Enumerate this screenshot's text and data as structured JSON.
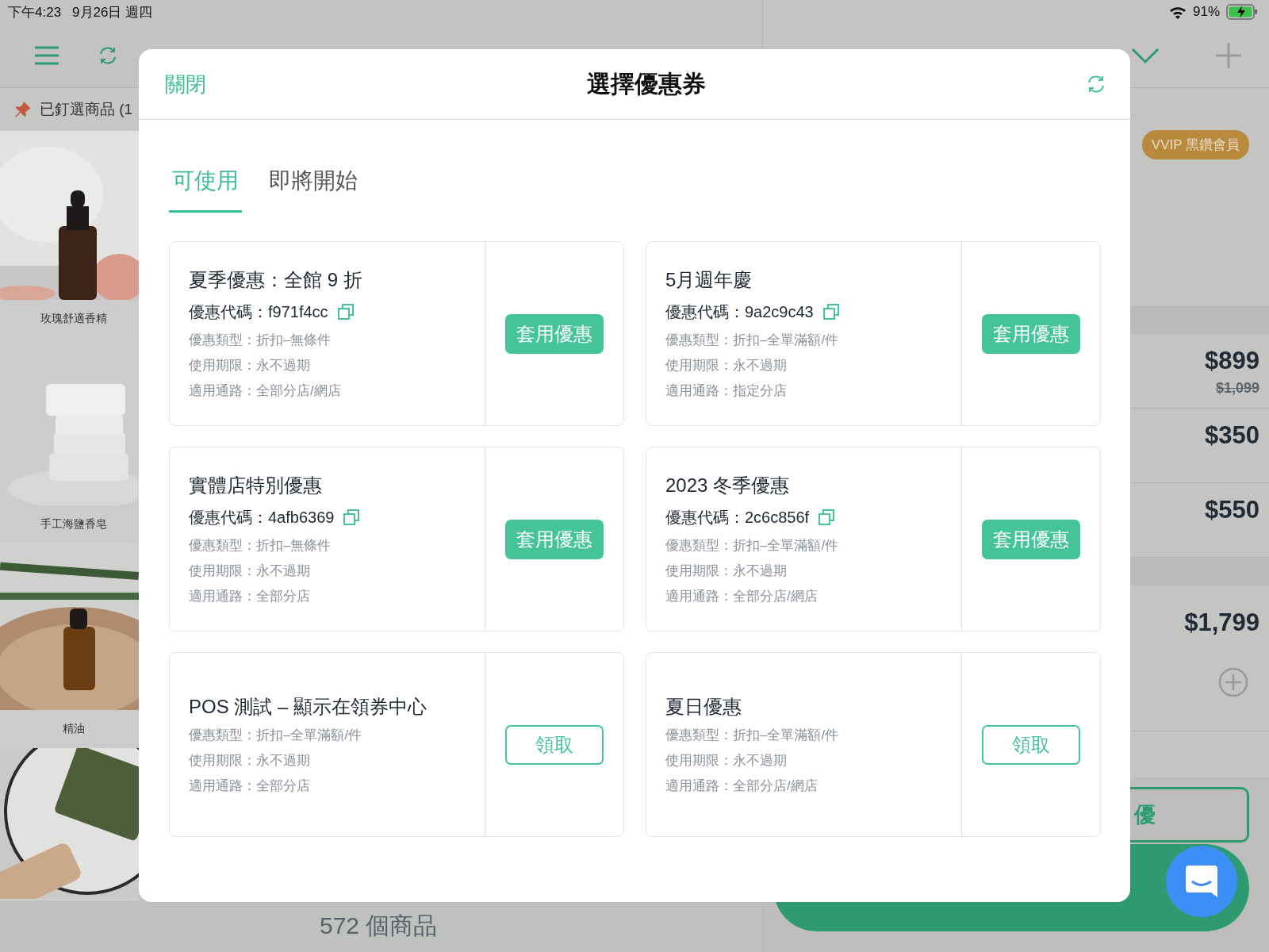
{
  "status_bar": {
    "time": "下午4:23",
    "date": "9月26日 週四",
    "battery": "91%"
  },
  "products": {
    "pinned_label": "已釘選商品 (1",
    "items": [
      {
        "name": "玫瑰舒適香精",
        "kind": "picture"
      },
      {
        "name": "手工海鹽香皂",
        "kind": "picture"
      },
      {
        "name": "精油",
        "kind": "picture"
      },
      {
        "kind": "picture"
      }
    ],
    "count": "572 個商品"
  },
  "cart": {
    "badge": "VVIP 黑鑽會員",
    "lines": [
      {
        "price": "$899",
        "original_price": "$1,099"
      },
      {
        "price": "$350"
      },
      {
        "price": "$550"
      }
    ],
    "subtotal": "$1,799",
    "coupon_button": "優"
  },
  "modal": {
    "close": "關閉",
    "title": "選擇優惠券",
    "tabs": [
      {
        "label": "可使用",
        "selected": true
      },
      {
        "label": "即將開始",
        "selected": false
      }
    ],
    "coupons": [
      {
        "kind": "apply",
        "title": "夏季優惠：全館 9 折",
        "code": "優惠代碼：f971f4cc",
        "details": [
          "優惠類型：折扣–無條件",
          "使用期限：永不過期",
          "適用通路：全部分店/網店"
        ],
        "action": "套用優惠"
      },
      {
        "kind": "apply",
        "title": "5月週年慶",
        "code": "優惠代碼：9a2c9c43",
        "details": [
          "優惠類型：折扣–全單滿額/件",
          "使用期限：永不過期",
          "適用通路：指定分店"
        ],
        "action": "套用優惠"
      },
      {
        "kind": "apply",
        "title": "實體店特別優惠",
        "code": "優惠代碼：4afb6369",
        "details": [
          "優惠類型：折扣–無條件",
          "使用期限：永不過期",
          "適用通路：全部分店"
        ],
        "action": "套用優惠"
      },
      {
        "kind": "apply",
        "title": "2023 冬季優惠",
        "code": "優惠代碼：2c6c856f",
        "details": [
          "優惠類型：折扣–全單滿額/件",
          "使用期限：永不過期",
          "適用通路：全部分店/網店"
        ],
        "action": "套用優惠"
      },
      {
        "kind": "claim",
        "title": "POS 測試 – 顯示在領券中心",
        "details": [
          "優惠類型：折扣–全單滿額/件",
          "使用期限：永不過期",
          "適用通路：全部分店"
        ],
        "action": "領取"
      },
      {
        "kind": "claim",
        "title": "夏日優惠",
        "details": [
          "優惠類型：折扣–全單滿額/件",
          "使用期限：永不過期",
          "適用通路：全部分店/網店"
        ],
        "action": "領取"
      }
    ]
  }
}
